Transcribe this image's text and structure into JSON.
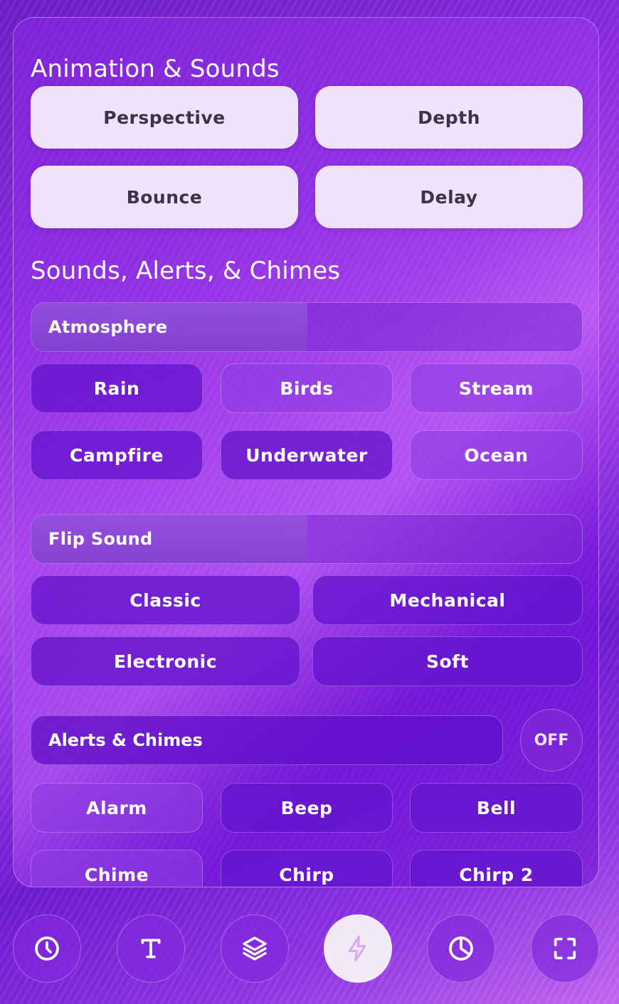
{
  "animation": {
    "title": "Animation & Sounds",
    "buttons": [
      "Perspective",
      "Depth",
      "Bounce",
      "Delay"
    ]
  },
  "sounds": {
    "title": "Sounds, Alerts, & Chimes",
    "atmosphere": {
      "label": "Atmosphere",
      "options": [
        "Rain",
        "Birds",
        "Stream",
        "Campfire",
        "Underwater",
        "Ocean"
      ]
    },
    "flip": {
      "label": "Flip Sound",
      "options": [
        "Classic",
        "Mechanical",
        "Electronic",
        "Soft"
      ]
    },
    "alerts": {
      "label": "Alerts & Chimes",
      "toggle": "OFF",
      "options": [
        "Alarm",
        "Beep",
        "Bell",
        "Chime",
        "Chirp",
        "Chirp 2"
      ]
    }
  },
  "nav": {
    "items": [
      {
        "icon": "clock-icon"
      },
      {
        "icon": "text-icon"
      },
      {
        "icon": "layers-icon"
      },
      {
        "icon": "lightning-icon",
        "active": true
      },
      {
        "icon": "pie-chart-icon"
      },
      {
        "icon": "fullscreen-icon"
      }
    ]
  },
  "colors": {
    "accent": "#8a2be2",
    "light_button": "#efe3fb",
    "active_nav": "#f2eaf8",
    "active_icon": "#d8a8f5"
  }
}
